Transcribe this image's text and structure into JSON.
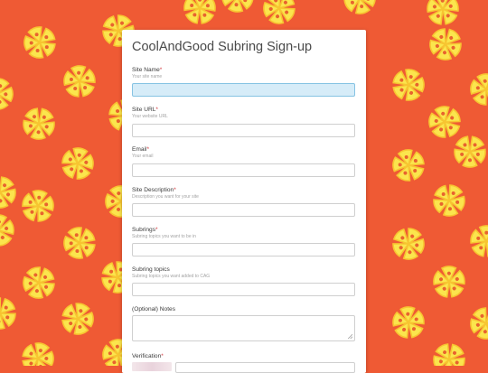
{
  "colors": {
    "background": "#ef5a34",
    "pizza": "#fbe54d",
    "pizza_crust": "#f7c531",
    "pepperoni": "#e8632e",
    "required": "#d0343a",
    "focus": "#d6ecf8"
  },
  "background_pattern": {
    "icon": "pizza-slices-icon"
  },
  "form": {
    "title": "CoolAndGood Subring Sign-up",
    "fields": [
      {
        "label": "Site Name",
        "required": "*",
        "sublabel": "Your site name",
        "value": "",
        "focused": true
      },
      {
        "label": "Site URL",
        "required": "*",
        "sublabel": "Your website URL",
        "value": ""
      },
      {
        "label": "Email",
        "required": "*",
        "sublabel": "Your email",
        "value": ""
      },
      {
        "label": "Site Description",
        "required": "*",
        "sublabel": "Description you want for your site",
        "value": ""
      },
      {
        "label": "Subrings",
        "required": "*",
        "sublabel": "Subring topics you want to be in",
        "value": ""
      },
      {
        "label": "Subring topics",
        "required": "",
        "sublabel": "Subring topics you want added to CAG",
        "value": ""
      },
      {
        "label": "(Optional) Notes",
        "required": "",
        "sublabel": "",
        "value": ""
      },
      {
        "label": "Verification",
        "required": "*",
        "sublabel": "",
        "value": ""
      }
    ]
  }
}
